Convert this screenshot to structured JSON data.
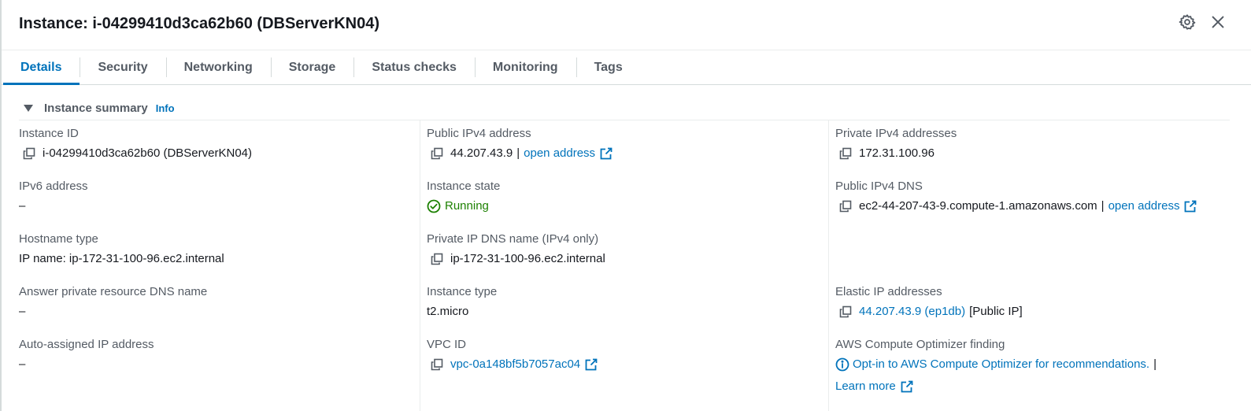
{
  "panel": {
    "title": "Instance: i-04299410d3ca62b60 (DBServerKN04)"
  },
  "tabs": [
    {
      "label": "Details",
      "active": true
    },
    {
      "label": "Security",
      "active": false
    },
    {
      "label": "Networking",
      "active": false
    },
    {
      "label": "Storage",
      "active": false
    },
    {
      "label": "Status checks",
      "active": false
    },
    {
      "label": "Monitoring",
      "active": false
    },
    {
      "label": "Tags",
      "active": false
    }
  ],
  "summary": {
    "title": "Instance summary",
    "info": "Info"
  },
  "fields": {
    "instance_id": {
      "label": "Instance ID",
      "value": "i-04299410d3ca62b60 (DBServerKN04)"
    },
    "ipv6_address": {
      "label": "IPv6 address",
      "value": "–"
    },
    "hostname_type": {
      "label": "Hostname type",
      "value": "IP name: ip-172-31-100-96.ec2.internal"
    },
    "answer_dns": {
      "label": "Answer private resource DNS name",
      "value": "–"
    },
    "auto_ip": {
      "label": "Auto-assigned IP address",
      "value": "–"
    },
    "public_ipv4": {
      "label": "Public IPv4 address",
      "value": "44.207.43.9",
      "sep": "|",
      "link": "open address"
    },
    "instance_state": {
      "label": "Instance state",
      "value": "Running"
    },
    "private_dns": {
      "label": "Private IP DNS name (IPv4 only)",
      "value": "ip-172-31-100-96.ec2.internal"
    },
    "instance_type": {
      "label": "Instance type",
      "value": "t2.micro"
    },
    "vpc_id": {
      "label": "VPC ID",
      "value": "vpc-0a148bf5b7057ac04"
    },
    "private_ipv4": {
      "label": "Private IPv4 addresses",
      "value": "172.31.100.96"
    },
    "public_dns": {
      "label": "Public IPv4 DNS",
      "value": "ec2-44-207-43-9.compute-1.amazonaws.com",
      "sep": "|",
      "link": "open address"
    },
    "elastic_ip": {
      "label": "Elastic IP addresses",
      "link": "44.207.43.9 (ep1db)",
      "suffix": "[Public IP]"
    },
    "optimizer": {
      "label": "AWS Compute Optimizer finding",
      "link": "Opt-in to AWS Compute Optimizer for recommendations.",
      "sep": "|",
      "learn_more": "Learn more"
    }
  },
  "colors": {
    "link": "#0073bb",
    "success": "#1d8102",
    "label": "#545b64",
    "text": "#16191f"
  },
  "icons": {
    "settings": "gear-icon",
    "close": "close-icon",
    "copy": "copy-icon",
    "external": "external-link-icon",
    "status": "check-circle-icon",
    "info": "info-circle-icon"
  }
}
